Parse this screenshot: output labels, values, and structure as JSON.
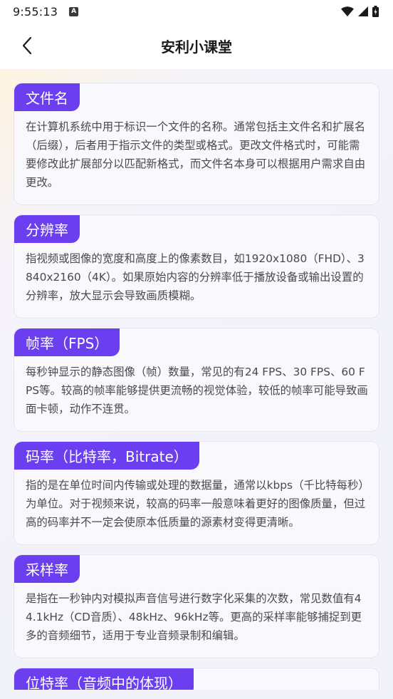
{
  "status_bar": {
    "time": "9:55:13",
    "notification_letter": "A"
  },
  "header": {
    "title": "安利小课堂"
  },
  "colors": {
    "accent": "#6b3ef0",
    "card_bg": "#f8f8fd",
    "text": "#4a4a4a"
  },
  "cards": [
    {
      "title": "文件名",
      "desc": "在计算机系统中用于标识一个文件的名称。通常包括主文件名和扩展名（后缀），后者用于指示文件的类型或格式。更改文件格式时，可能需要修改此扩展部分以匹配新格式，而文件名本身可以根据用户需求自由更改。"
    },
    {
      "title": "分辨率",
      "desc": "指视频或图像的宽度和高度上的像素数目，如1920x1080（FHD）、3840x2160（4K）。如果原始内容的分辨率低于播放设备或输出设置的分辨率，放大显示会导致画质模糊。"
    },
    {
      "title": "帧率（FPS）",
      "desc": "每秒钟显示的静态图像（帧）数量，常见的有24 FPS、30 FPS、60 FPS等。较高的帧率能够提供更流畅的视觉体验，较低的帧率可能导致画面卡顿，动作不连贯。"
    },
    {
      "title": "码率（比特率，Bitrate）",
      "desc": "指的是在单位时间内传输或处理的数据量，通常以kbps（千比特每秒）为单位。对于视频来说，较高的码率一般意味着更好的图像质量，但过高的码率并不一定会使原本低质量的源素材变得更清晰。"
    },
    {
      "title": "采样率",
      "desc": "是指在一秒钟内对模拟声音信号进行数字化采集的次数，常见数值有44.1kHz（CD音质）、48kHz、96kHz等。更高的采样率能够捕捉到更多的音频细节，适用于专业音频录制和编辑。"
    },
    {
      "title": "位特率（音频中的体现）",
      "desc": ""
    }
  ]
}
